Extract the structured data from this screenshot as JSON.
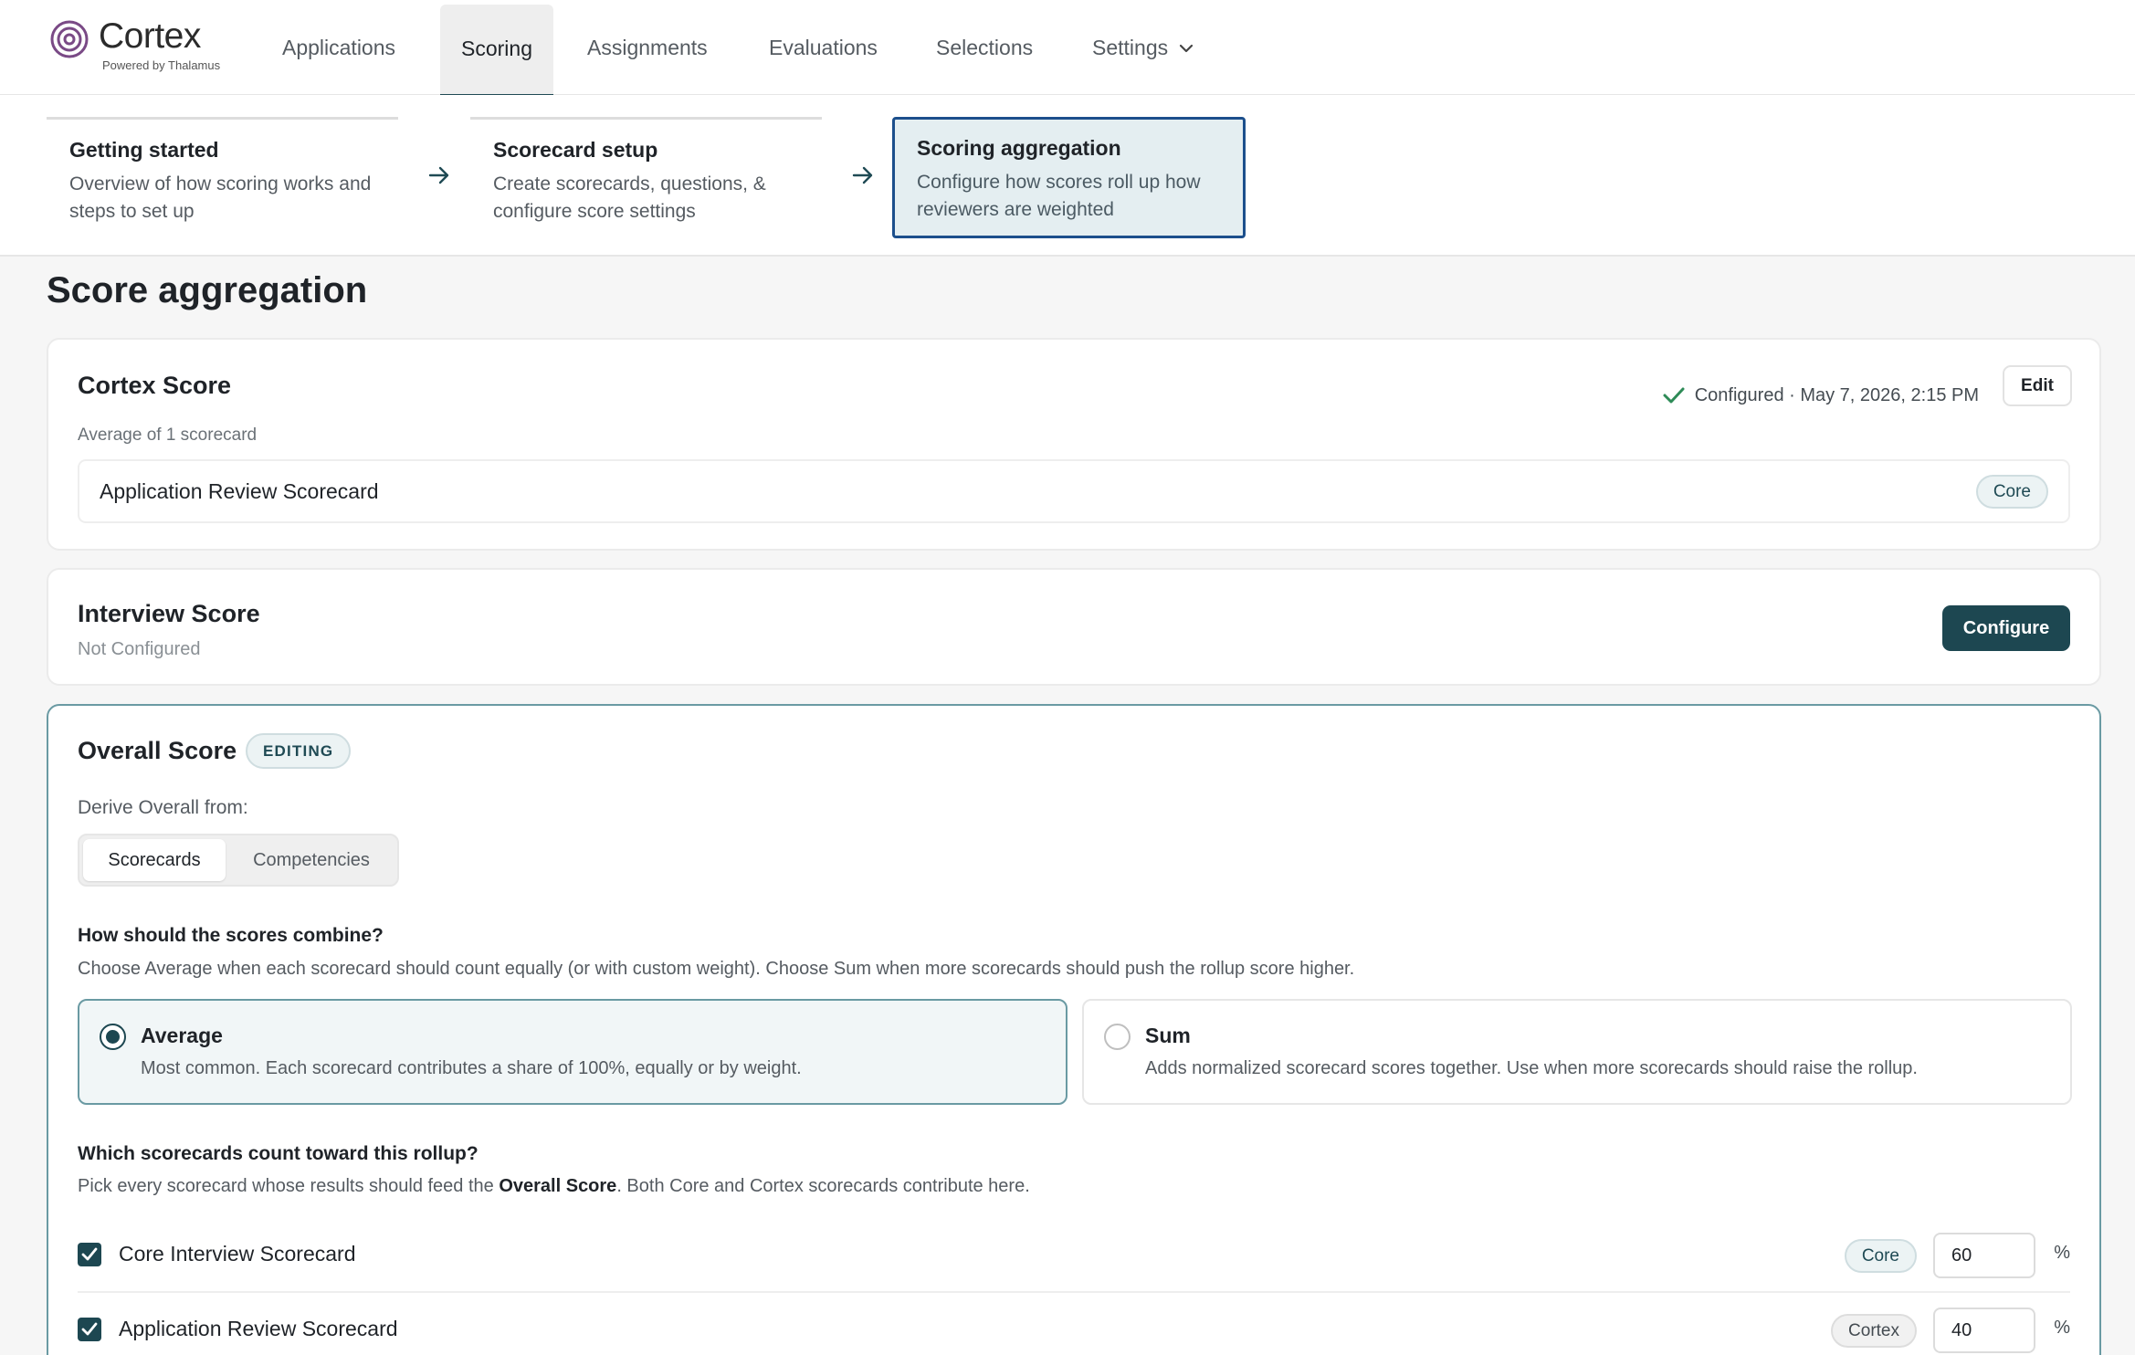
{
  "app": {
    "name": "Cortex",
    "tagline": "Powered by Thalamus"
  },
  "nav": {
    "items": [
      {
        "label": "Applications"
      },
      {
        "label": "Scoring"
      },
      {
        "label": "Assignments"
      },
      {
        "label": "Evaluations"
      },
      {
        "label": "Selections"
      },
      {
        "label": "Settings"
      }
    ],
    "active": "Scoring"
  },
  "stepper": {
    "steps": [
      {
        "title": "Getting started",
        "desc": "Overview of how scoring works and steps to set up"
      },
      {
        "title": "Scorecard setup",
        "desc": "Create scorecards, questions, & configure score settings"
      },
      {
        "title": "Scoring aggregation",
        "desc": "Configure how scores roll up how reviewers are weighted"
      }
    ],
    "active_index": 2
  },
  "page": {
    "title": "Score aggregation"
  },
  "cortex_score": {
    "title": "Cortex Score",
    "status": "Configured · May 7, 2026, 2:15 PM",
    "edit_label": "Edit",
    "subtitle": "Average of 1 scorecard",
    "scorecards": [
      {
        "name": "Application Review Scorecard",
        "tag": "Core"
      }
    ]
  },
  "interview_score": {
    "title": "Interview Score",
    "status": "Not Configured",
    "configure_label": "Configure"
  },
  "overall_score": {
    "title": "Overall Score",
    "badge": "EDITING",
    "derive_label": "Derive Overall from:",
    "derive_options": [
      "Scorecards",
      "Competencies"
    ],
    "derive_selected": "Scorecards",
    "combine_question": "How should the scores combine?",
    "combine_help": "Choose Average when each scorecard should count equally (or with custom weight). Choose Sum when more scorecards should push the rollup score higher.",
    "combine_options": [
      {
        "title": "Average",
        "desc": "Most common. Each scorecard contributes a share of 100%, equally or by weight.",
        "selected": true
      },
      {
        "title": "Sum",
        "desc": "Adds normalized scorecard scores together. Use when more scorecards should raise the rollup.",
        "selected": false
      }
    ],
    "rollup_question": "Which scorecards count toward this rollup?",
    "rollup_help_pre": "Pick every scorecard whose results should feed the ",
    "rollup_help_bold": "Overall Score",
    "rollup_help_post": ". Both Core and Cortex scorecards contribute here.",
    "scorecards": [
      {
        "name": "Core Interview Scorecard",
        "tag": "Core",
        "weight": "60",
        "unit": "%",
        "checked": true
      },
      {
        "name": "Application Review Scorecard",
        "tag": "Cortex",
        "weight": "40",
        "unit": "%",
        "checked": true
      }
    ]
  },
  "colors": {
    "primary": "#1d4751",
    "active_step_border": "#1c4f8c",
    "success": "#2e8b57"
  }
}
